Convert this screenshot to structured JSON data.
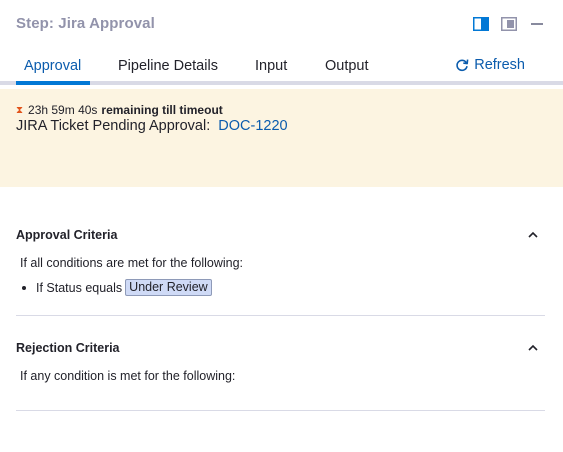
{
  "header": {
    "title": "Step: Jira Approval",
    "icons": [
      "dock-right-icon",
      "dock-float-icon",
      "minimize-icon"
    ]
  },
  "tabs": [
    {
      "label": "Approval",
      "active": true
    },
    {
      "label": "Pipeline Details",
      "active": false
    },
    {
      "label": "Input",
      "active": false
    },
    {
      "label": "Output",
      "active": false
    }
  ],
  "refresh": {
    "label": "Refresh",
    "icon": "refresh-icon"
  },
  "banner": {
    "timer": "23h 59m 40s",
    "timer_suffix": "remaining till timeout",
    "ticket_label": "JIRA Ticket Pending Approval:",
    "ticket_id": "DOC-1220"
  },
  "approval": {
    "title": "Approval Criteria",
    "condition_intro": "If all conditions are met for the following:",
    "rules": [
      {
        "prefix": "If Status equals",
        "value": "Under Review"
      }
    ]
  },
  "rejection": {
    "title": "Rejection Criteria",
    "condition_intro": "If any condition is met for the following:"
  },
  "colors": {
    "accent": "#0b5cad",
    "tab_underline": "#0278d5",
    "banner_bg": "#fcf4e1",
    "chip_bg": "#cfdaf6"
  }
}
